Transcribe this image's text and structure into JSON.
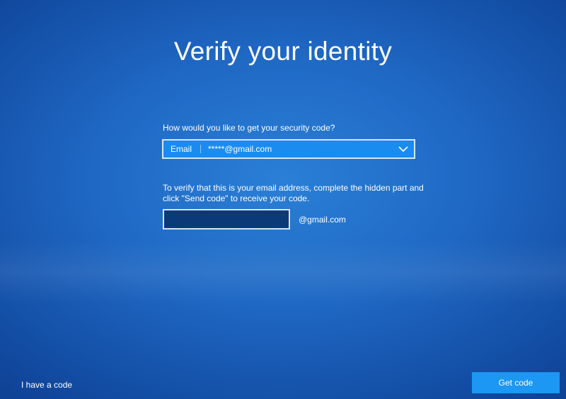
{
  "page": {
    "title": "Verify your identity"
  },
  "method": {
    "question": "How would you like to get your security code?",
    "type_label": "Email",
    "selected_value": "*****@gmail.com",
    "icon": "chevron-down-icon"
  },
  "verify": {
    "instructions": "To verify that this is your email address, complete the hidden part and click \"Send code\" to receive your code.",
    "input_value": "",
    "domain_suffix": "@gmail.com"
  },
  "footer": {
    "have_code_label": "I have a code",
    "get_code_label": "Get code"
  },
  "colors": {
    "background": "#1f68c4",
    "select_fill": "#1a8cf0",
    "input_fill": "#0b3a78",
    "button_fill": "#1c97f3",
    "text": "#ffffff"
  }
}
